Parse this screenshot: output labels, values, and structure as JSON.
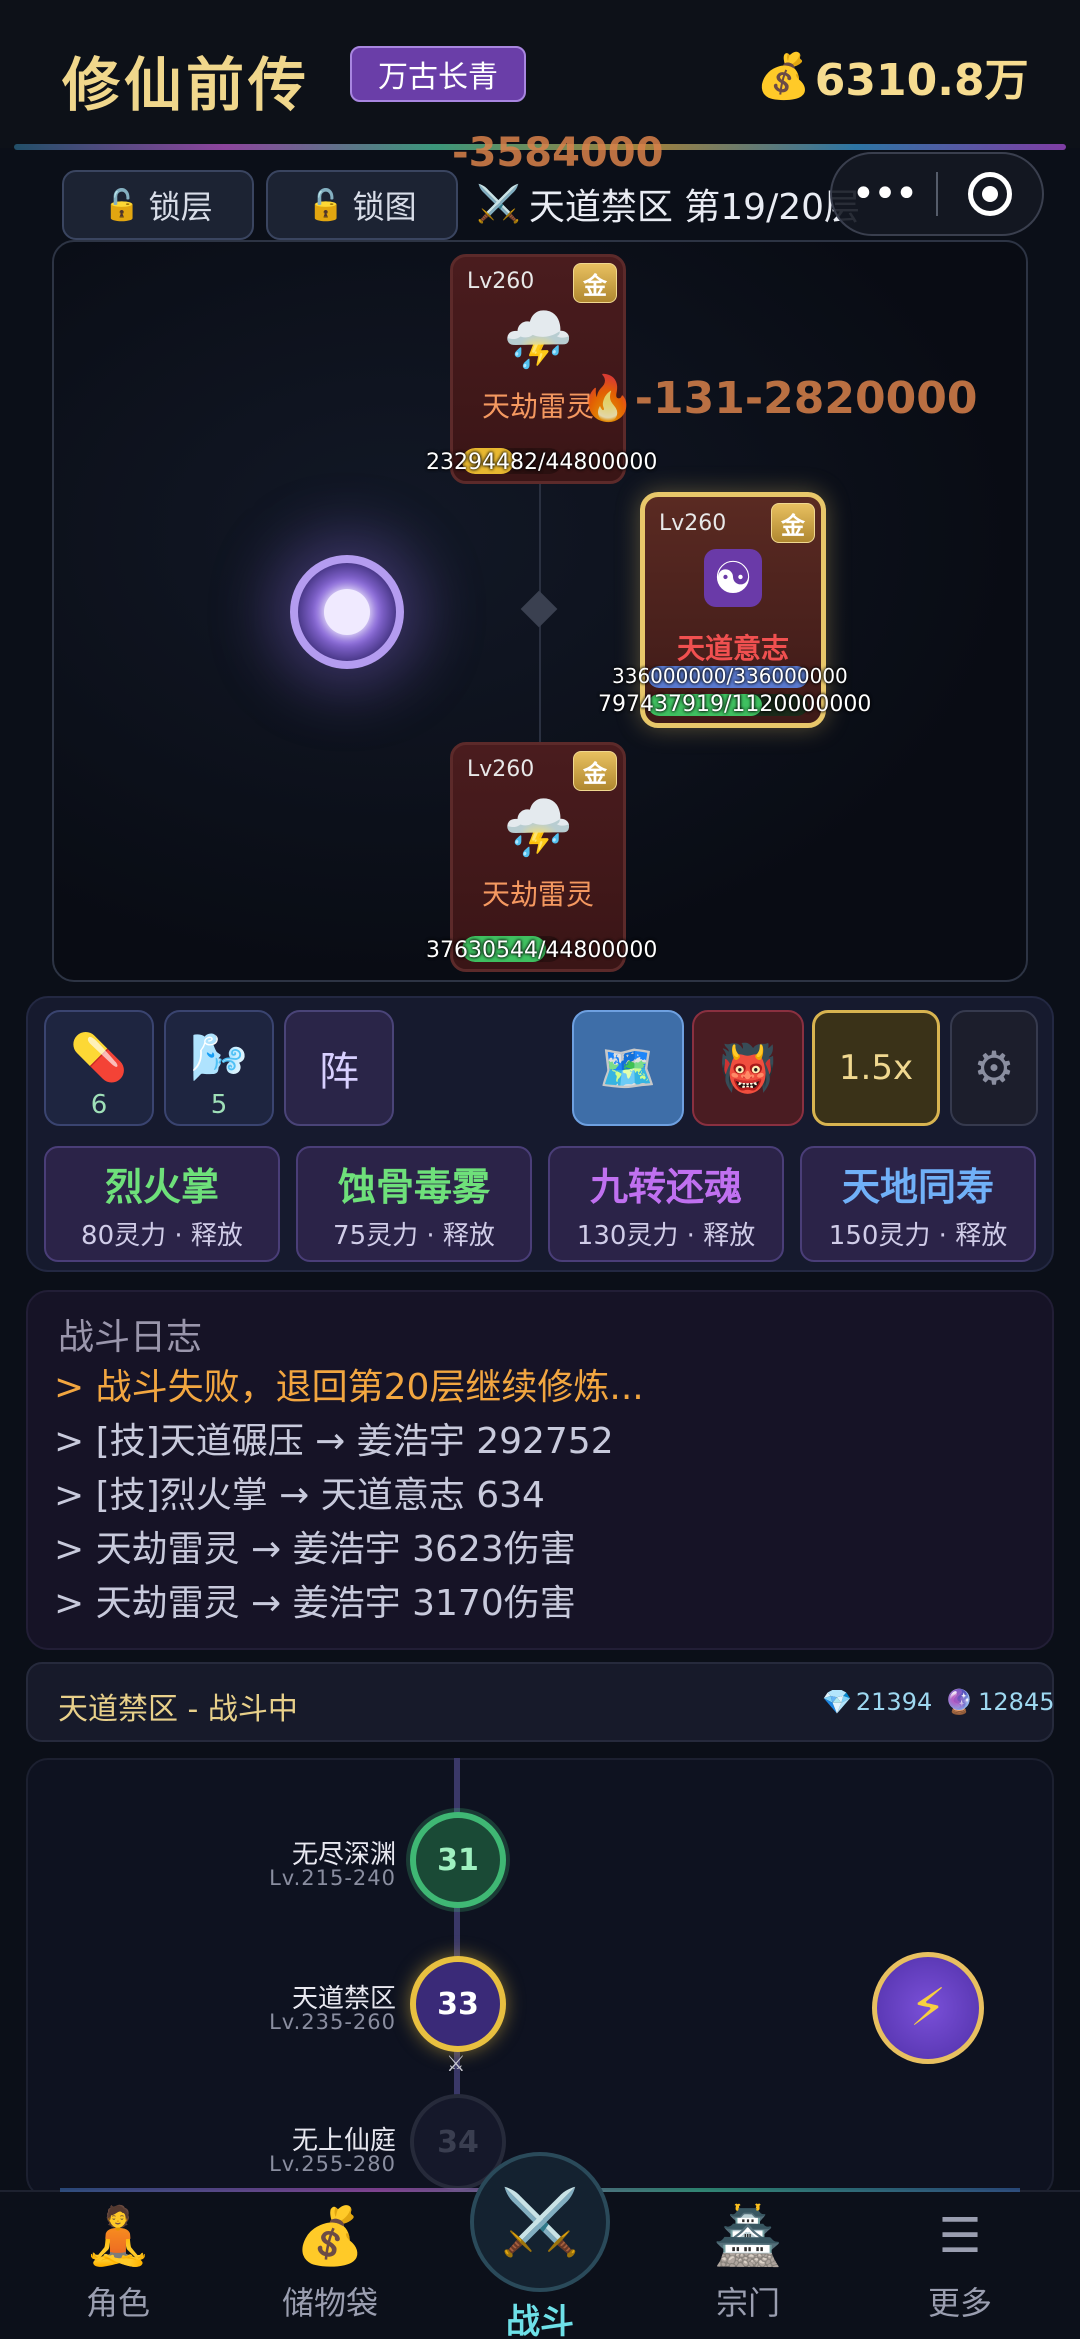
{
  "header": {
    "title": "修仙前传",
    "realm": "万古长青",
    "coins": "6310.8万",
    "coin_icon": "money-bag-icon"
  },
  "floating_damage": {
    "top": "-3584000",
    "mid": "-131-2820000"
  },
  "controls": {
    "lock_floor": "锁层",
    "lock_map": "锁图",
    "stage": "天道禁区 第19/20层"
  },
  "enemies": [
    {
      "level": "Lv260",
      "tier": "金",
      "name": "天劫雷灵",
      "hp_text": "23294482/44800000",
      "hp_ratio": 0.52,
      "hp_color": "#e8b830"
    },
    {
      "level": "Lv260",
      "tier": "金",
      "name": "天劫雷灵",
      "hp_text": "37630544/44800000",
      "hp_ratio": 0.84,
      "hp_color": "#3fc060"
    }
  ],
  "boss": {
    "level": "Lv260",
    "tier": "金",
    "name": "天道意志",
    "shield_text": "336000000/336000000",
    "shield_ratio": 1.0,
    "hp_text": "797437919/1120000000",
    "hp_ratio": 0.71
  },
  "items": [
    {
      "icon": "pill-icon",
      "count": "6"
    },
    {
      "icon": "wind-icon",
      "count": "5"
    }
  ],
  "formation_label": "阵",
  "speed": "1.5x",
  "skills": [
    {
      "name": "烈火掌",
      "cost": "80灵力 · 释放",
      "color": "#6ee07a"
    },
    {
      "name": "蚀骨毒雾",
      "cost": "75灵力 · 释放",
      "color": "#6ee07a"
    },
    {
      "name": "九转还魂",
      "cost": "130灵力 · 释放",
      "color": "#c070f0"
    },
    {
      "name": "天地同寿",
      "cost": "150灵力 · 释放",
      "color": "#70b0f8"
    }
  ],
  "log": {
    "title": "战斗日志",
    "lines": [
      "> 战斗失败，退回第20层继续修炼...",
      "> [技]天道碾压 → 姜浩宇 292752",
      "> [技]烈火掌 → 天道意志 634",
      "> 天劫雷灵 → 姜浩宇 3623伤害",
      "> 天劫雷灵 → 姜浩宇 3170伤害"
    ]
  },
  "status": {
    "text": "天道禁区 - 战斗中",
    "gems": "21394",
    "orbs": "12845"
  },
  "map_nodes": [
    {
      "num": "31",
      "name": "无尽深渊",
      "range": "Lv.215-240"
    },
    {
      "num": "33",
      "name": "天道禁区",
      "range": "Lv.235-260"
    },
    {
      "num": "34",
      "name": "无上仙庭",
      "range": "Lv.255-280"
    }
  ],
  "nav": {
    "role": "角色",
    "bag": "储物袋",
    "battle": "战斗",
    "sect": "宗门",
    "more": "更多"
  }
}
